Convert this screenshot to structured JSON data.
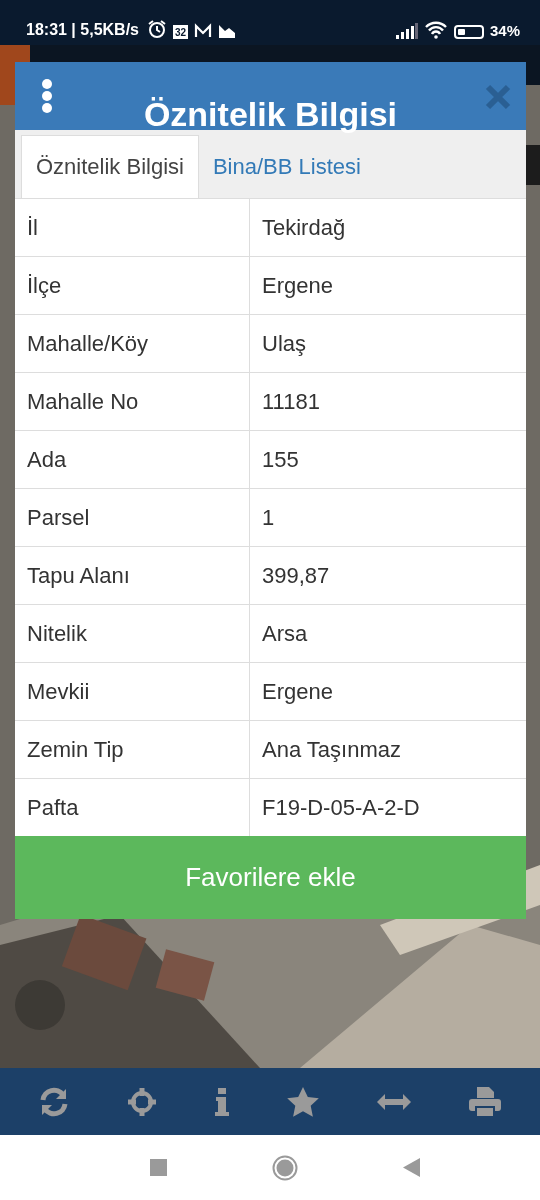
{
  "status_bar": {
    "time": "18:31 | 5,5KB/s",
    "calendar_day": "32",
    "battery": "34%"
  },
  "dialog": {
    "title": "Öznitelik Bilgisi",
    "tabs": [
      {
        "label": "Öznitelik Bilgisi",
        "selected": true
      },
      {
        "label": "Bina/BB Listesi",
        "selected": false
      }
    ],
    "rows": [
      {
        "label": "İl",
        "value": "Tekirdağ"
      },
      {
        "label": "İlçe",
        "value": "Ergene"
      },
      {
        "label": "Mahalle/Köy",
        "value": "Ulaş"
      },
      {
        "label": "Mahalle No",
        "value": "11181"
      },
      {
        "label": "Ada",
        "value": "155"
      },
      {
        "label": "Parsel",
        "value": "1"
      },
      {
        "label": "Tapu Alanı",
        "value": "399,87"
      },
      {
        "label": "Nitelik",
        "value": "Arsa"
      },
      {
        "label": "Mevkii",
        "value": "Ergene"
      },
      {
        "label": "Zemin Tip",
        "value": "Ana Taşınmaz"
      },
      {
        "label": "Pafta",
        "value": "F19-D-05-A-2-D"
      }
    ],
    "button": "Favorilere ekle"
  },
  "toolbar": [
    {
      "kind": "refresh"
    },
    {
      "kind": "locate"
    },
    {
      "kind": "info"
    },
    {
      "kind": "star"
    },
    {
      "kind": "measure"
    },
    {
      "kind": "print"
    }
  ]
}
